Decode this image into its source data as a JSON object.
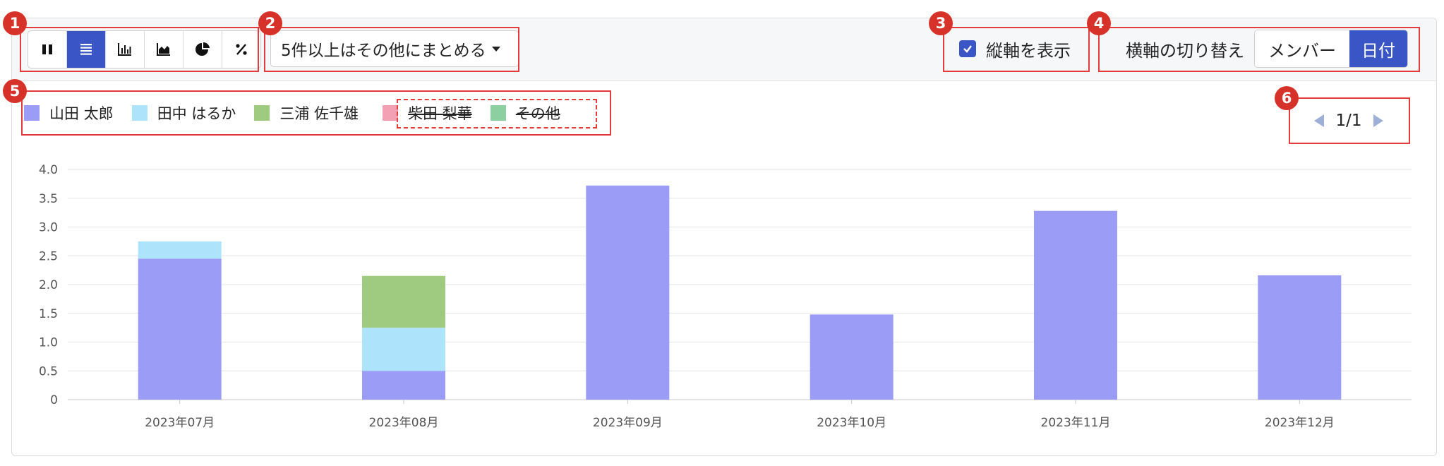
{
  "toolbar": {
    "view_buttons": [
      {
        "name": "pause-icon",
        "active": false
      },
      {
        "name": "list-icon",
        "active": true
      },
      {
        "name": "bar-chart-icon",
        "active": false
      },
      {
        "name": "area-chart-icon",
        "active": false
      },
      {
        "name": "pie-chart-icon",
        "active": false
      },
      {
        "name": "percent-icon",
        "active": false
      }
    ],
    "group_dropdown_label": "5件以上はその他にまとめる",
    "vertical_axis_label": "縦軸を表示",
    "vertical_axis_checked": true,
    "horizontal_axis_label": "横軸の切り替え",
    "horizontal_axis_options": [
      "メンバー",
      "日付"
    ],
    "horizontal_axis_selected": "日付"
  },
  "legend": [
    {
      "name": "山田 太郎",
      "color": "#9b9cf5",
      "hidden": false
    },
    {
      "name": "田中 はるか",
      "color": "#aee4fb",
      "hidden": false
    },
    {
      "name": "三浦 佐千雄",
      "color": "#9ecb80",
      "hidden": false
    },
    {
      "name": "柴田 梨華",
      "color": "#f3a0b5",
      "hidden": true
    },
    {
      "name": "その他",
      "color": "#8ccfa1",
      "hidden": true
    }
  ],
  "pager": {
    "text": "1/1"
  },
  "callouts": [
    "1",
    "2",
    "3",
    "4",
    "5",
    "6"
  ],
  "colors": {
    "accent": "#3a55c6",
    "callout": "#e33c3c"
  },
  "chart_data": {
    "type": "bar",
    "stacked": true,
    "categories": [
      "2023年07月",
      "2023年08月",
      "2023年09月",
      "2023年10月",
      "2023年11月",
      "2023年12月"
    ],
    "series": [
      {
        "name": "山田 太郎",
        "color": "#9b9cf5",
        "values": [
          2.45,
          0.5,
          3.72,
          1.48,
          3.28,
          2.16
        ]
      },
      {
        "name": "田中 はるか",
        "color": "#aee4fb",
        "values": [
          0.3,
          0.75,
          0,
          0,
          0,
          0
        ]
      },
      {
        "name": "三浦 佐千雄",
        "color": "#9ecb80",
        "values": [
          0,
          0.9,
          0,
          0,
          0,
          0
        ]
      }
    ],
    "yticks": [
      "0",
      "0.5",
      "1.0",
      "1.5",
      "2.0",
      "2.5",
      "3.0",
      "3.5",
      "4.0"
    ],
    "ylim": [
      0,
      4.0
    ],
    "grid": true,
    "legend_position": "top-left"
  }
}
